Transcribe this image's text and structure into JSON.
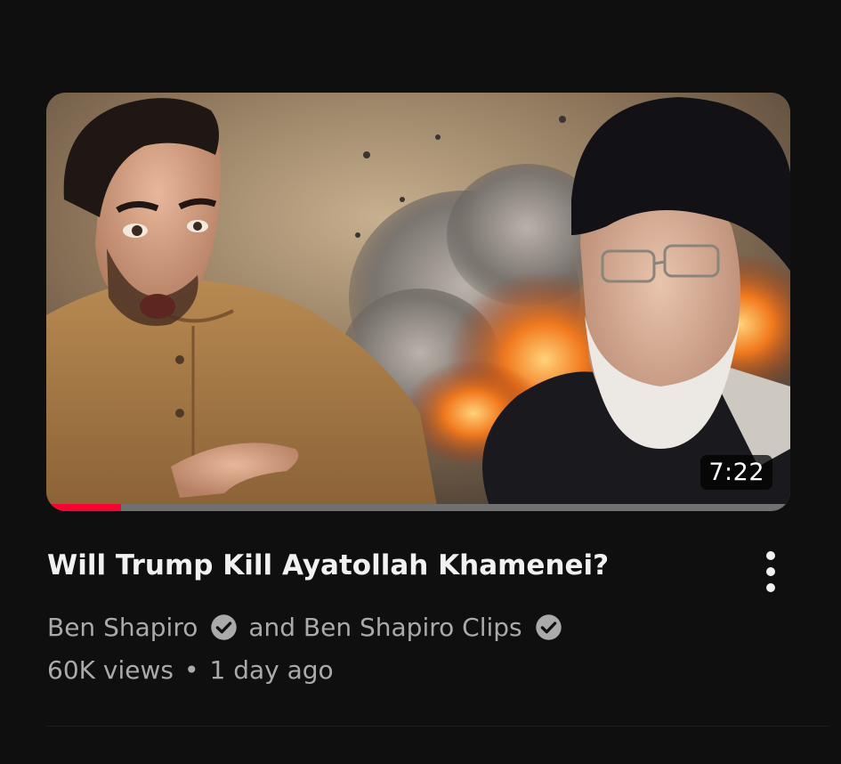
{
  "video": {
    "title": "Will Trump Kill Ayatollah Khamenei?",
    "duration": "7:22",
    "watch_progress": 0.1,
    "channels": {
      "primary": "Ben Shapiro",
      "connector": "and Ben Shapiro Clips",
      "primary_verified": true,
      "secondary_verified": true
    },
    "views": "60K views",
    "separator": "•",
    "age": "1 day ago"
  },
  "icons": {
    "verified": "verified-check-icon",
    "menu": "more-vert-icon"
  },
  "colors": {
    "background": "#0f0f0f",
    "title_text": "#f1f1f1",
    "meta_text": "#aaaaaa",
    "progress_watched": "#ff0033",
    "progress_track": "#717171"
  }
}
